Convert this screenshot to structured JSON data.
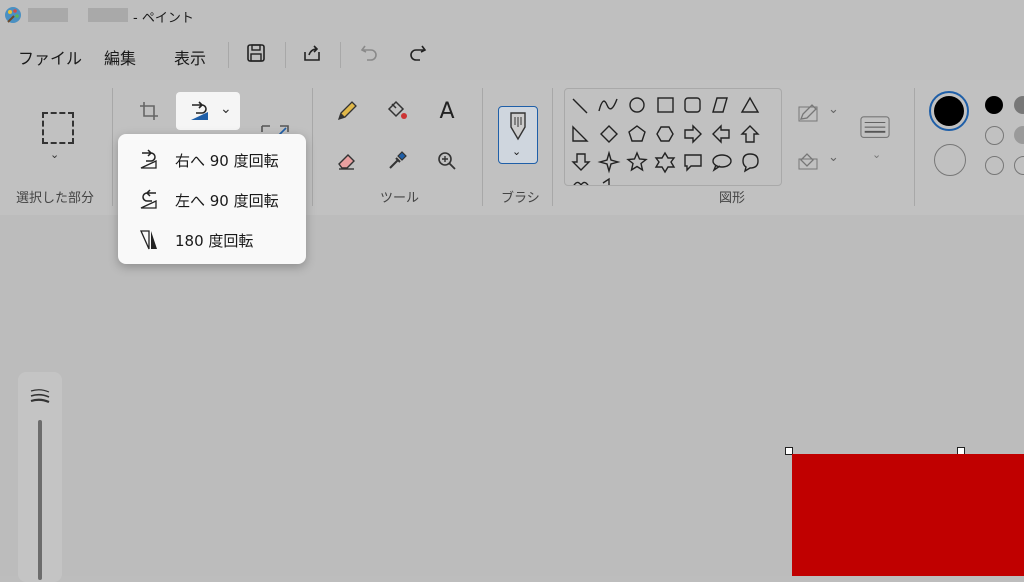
{
  "window": {
    "title": "- ペイント",
    "icon": "paint-palette-icon"
  },
  "menu": {
    "file": "ファイル",
    "edit": "編集",
    "view": "表示"
  },
  "quick_access": {
    "save_icon": "save-icon",
    "share_icon": "share-icon",
    "undo_icon": "undo-icon",
    "redo_icon": "redo-icon"
  },
  "ribbon": {
    "selection_label": "選択した部分",
    "tools_label": "ツール",
    "brush_label": "ブラシ",
    "shapes_label": "図形"
  },
  "rotate_menu": {
    "items": [
      {
        "label": "右へ 90 度回転",
        "icon": "rotate-right-icon"
      },
      {
        "label": "左へ 90 度回転",
        "icon": "rotate-left-icon"
      },
      {
        "label": "180 度回転",
        "icon": "rotate-180-icon"
      }
    ]
  },
  "colors": {
    "canvas_fill": "#c00000",
    "accent": "#1f5fa8",
    "background_dimmed": "#bdbdbd"
  }
}
